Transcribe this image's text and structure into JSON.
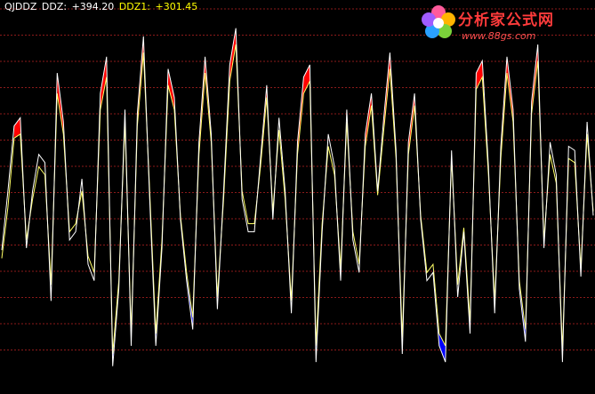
{
  "legend": {
    "indicator": "QJDDZ",
    "ddz_label": "DDZ:",
    "ddz_value": "+394.20",
    "ddz1_label": "DDZ1:",
    "ddz1_value": "+301.45"
  },
  "logo": {
    "brand": "分析家公式网",
    "url": "www.88gs.com"
  },
  "colors": {
    "background": "#000000",
    "grid": "#8b1a1a",
    "ddz_line": "#ffffff",
    "ddz1_line": "#ffff66",
    "fill_up": "#ff0000",
    "fill_down": "#0000ff",
    "legend_text": "#ffffff",
    "ddz1_text": "#ffff00",
    "logo_text": "#ff3b3b"
  },
  "chart_data": {
    "type": "line",
    "grid": "horizontal-dotted",
    "series": [
      {
        "name": "DDZ",
        "values": [
          375,
          520,
          680,
          700,
          380,
          520,
          610,
          590,
          250,
          810,
          690,
          400,
          420,
          550,
          340,
          300,
          760,
          850,
          90,
          280,
          720,
          140,
          710,
          900,
          500,
          140,
          380,
          820,
          750,
          450,
          300,
          180,
          640,
          850,
          660,
          230,
          520,
          830,
          920,
          500,
          420,
          420,
          600,
          780,
          450,
          700,
          520,
          220,
          640,
          800,
          830,
          100,
          420,
          660,
          580,
          300,
          720,
          400,
          320,
          660,
          760,
          520,
          700,
          860,
          620,
          120,
          640,
          760,
          450,
          300,
          320,
          140,
          100,
          620,
          260,
          420,
          170,
          810,
          840,
          580,
          220,
          630,
          850,
          720,
          280,
          150,
          740,
          880,
          380,
          640,
          560,
          100,
          630,
          620,
          310,
          690,
          460
        ]
      },
      {
        "name": "DDZ1",
        "values": [
          355,
          480,
          650,
          660,
          400,
          500,
          580,
          560,
          290,
          760,
          660,
          420,
          440,
          520,
          360,
          320,
          720,
          800,
          120,
          300,
          690,
          170,
          680,
          860,
          520,
          170,
          400,
          780,
          720,
          460,
          320,
          210,
          610,
          810,
          640,
          260,
          500,
          790,
          880,
          520,
          440,
          440,
          580,
          750,
          470,
          670,
          500,
          250,
          610,
          760,
          790,
          140,
          440,
          630,
          560,
          330,
          690,
          420,
          340,
          630,
          730,
          510,
          670,
          820,
          600,
          160,
          610,
          730,
          460,
          320,
          340,
          170,
          140,
          600,
          290,
          430,
          200,
          770,
          800,
          560,
          250,
          600,
          810,
          690,
          300,
          180,
          710,
          840,
          400,
          610,
          540,
          130,
          600,
          590,
          330,
          660,
          470
        ]
      }
    ]
  }
}
